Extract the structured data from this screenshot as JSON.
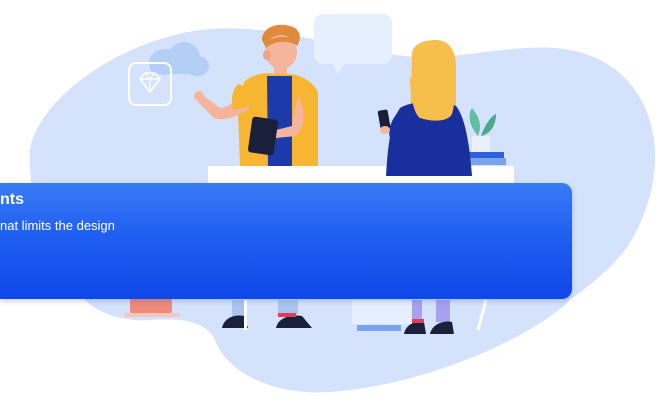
{
  "banner": {
    "title": "nts",
    "subtitle": "nat limits the design"
  },
  "illustration": {
    "icons": [
      "cloud-icon",
      "diamond-icon",
      "speech-bubble-icon",
      "plant-icon",
      "books-icon"
    ],
    "people": [
      "man-with-tablet",
      "woman-with-phone"
    ]
  },
  "colors": {
    "blob": "#d4e3fb",
    "banner_top": "#3a7bf5",
    "banner_bottom": "#0f47ea",
    "man_jacket": "#f7b531",
    "man_shirt": "#1c3aa9",
    "woman_hair": "#f7bd4d",
    "woman_sweater": "#1a2f9e",
    "pants_light": "#aac6ef",
    "pants_purple": "#a7a1f0",
    "shoe": "#1a1f3a",
    "pot": "#f08b7a"
  }
}
